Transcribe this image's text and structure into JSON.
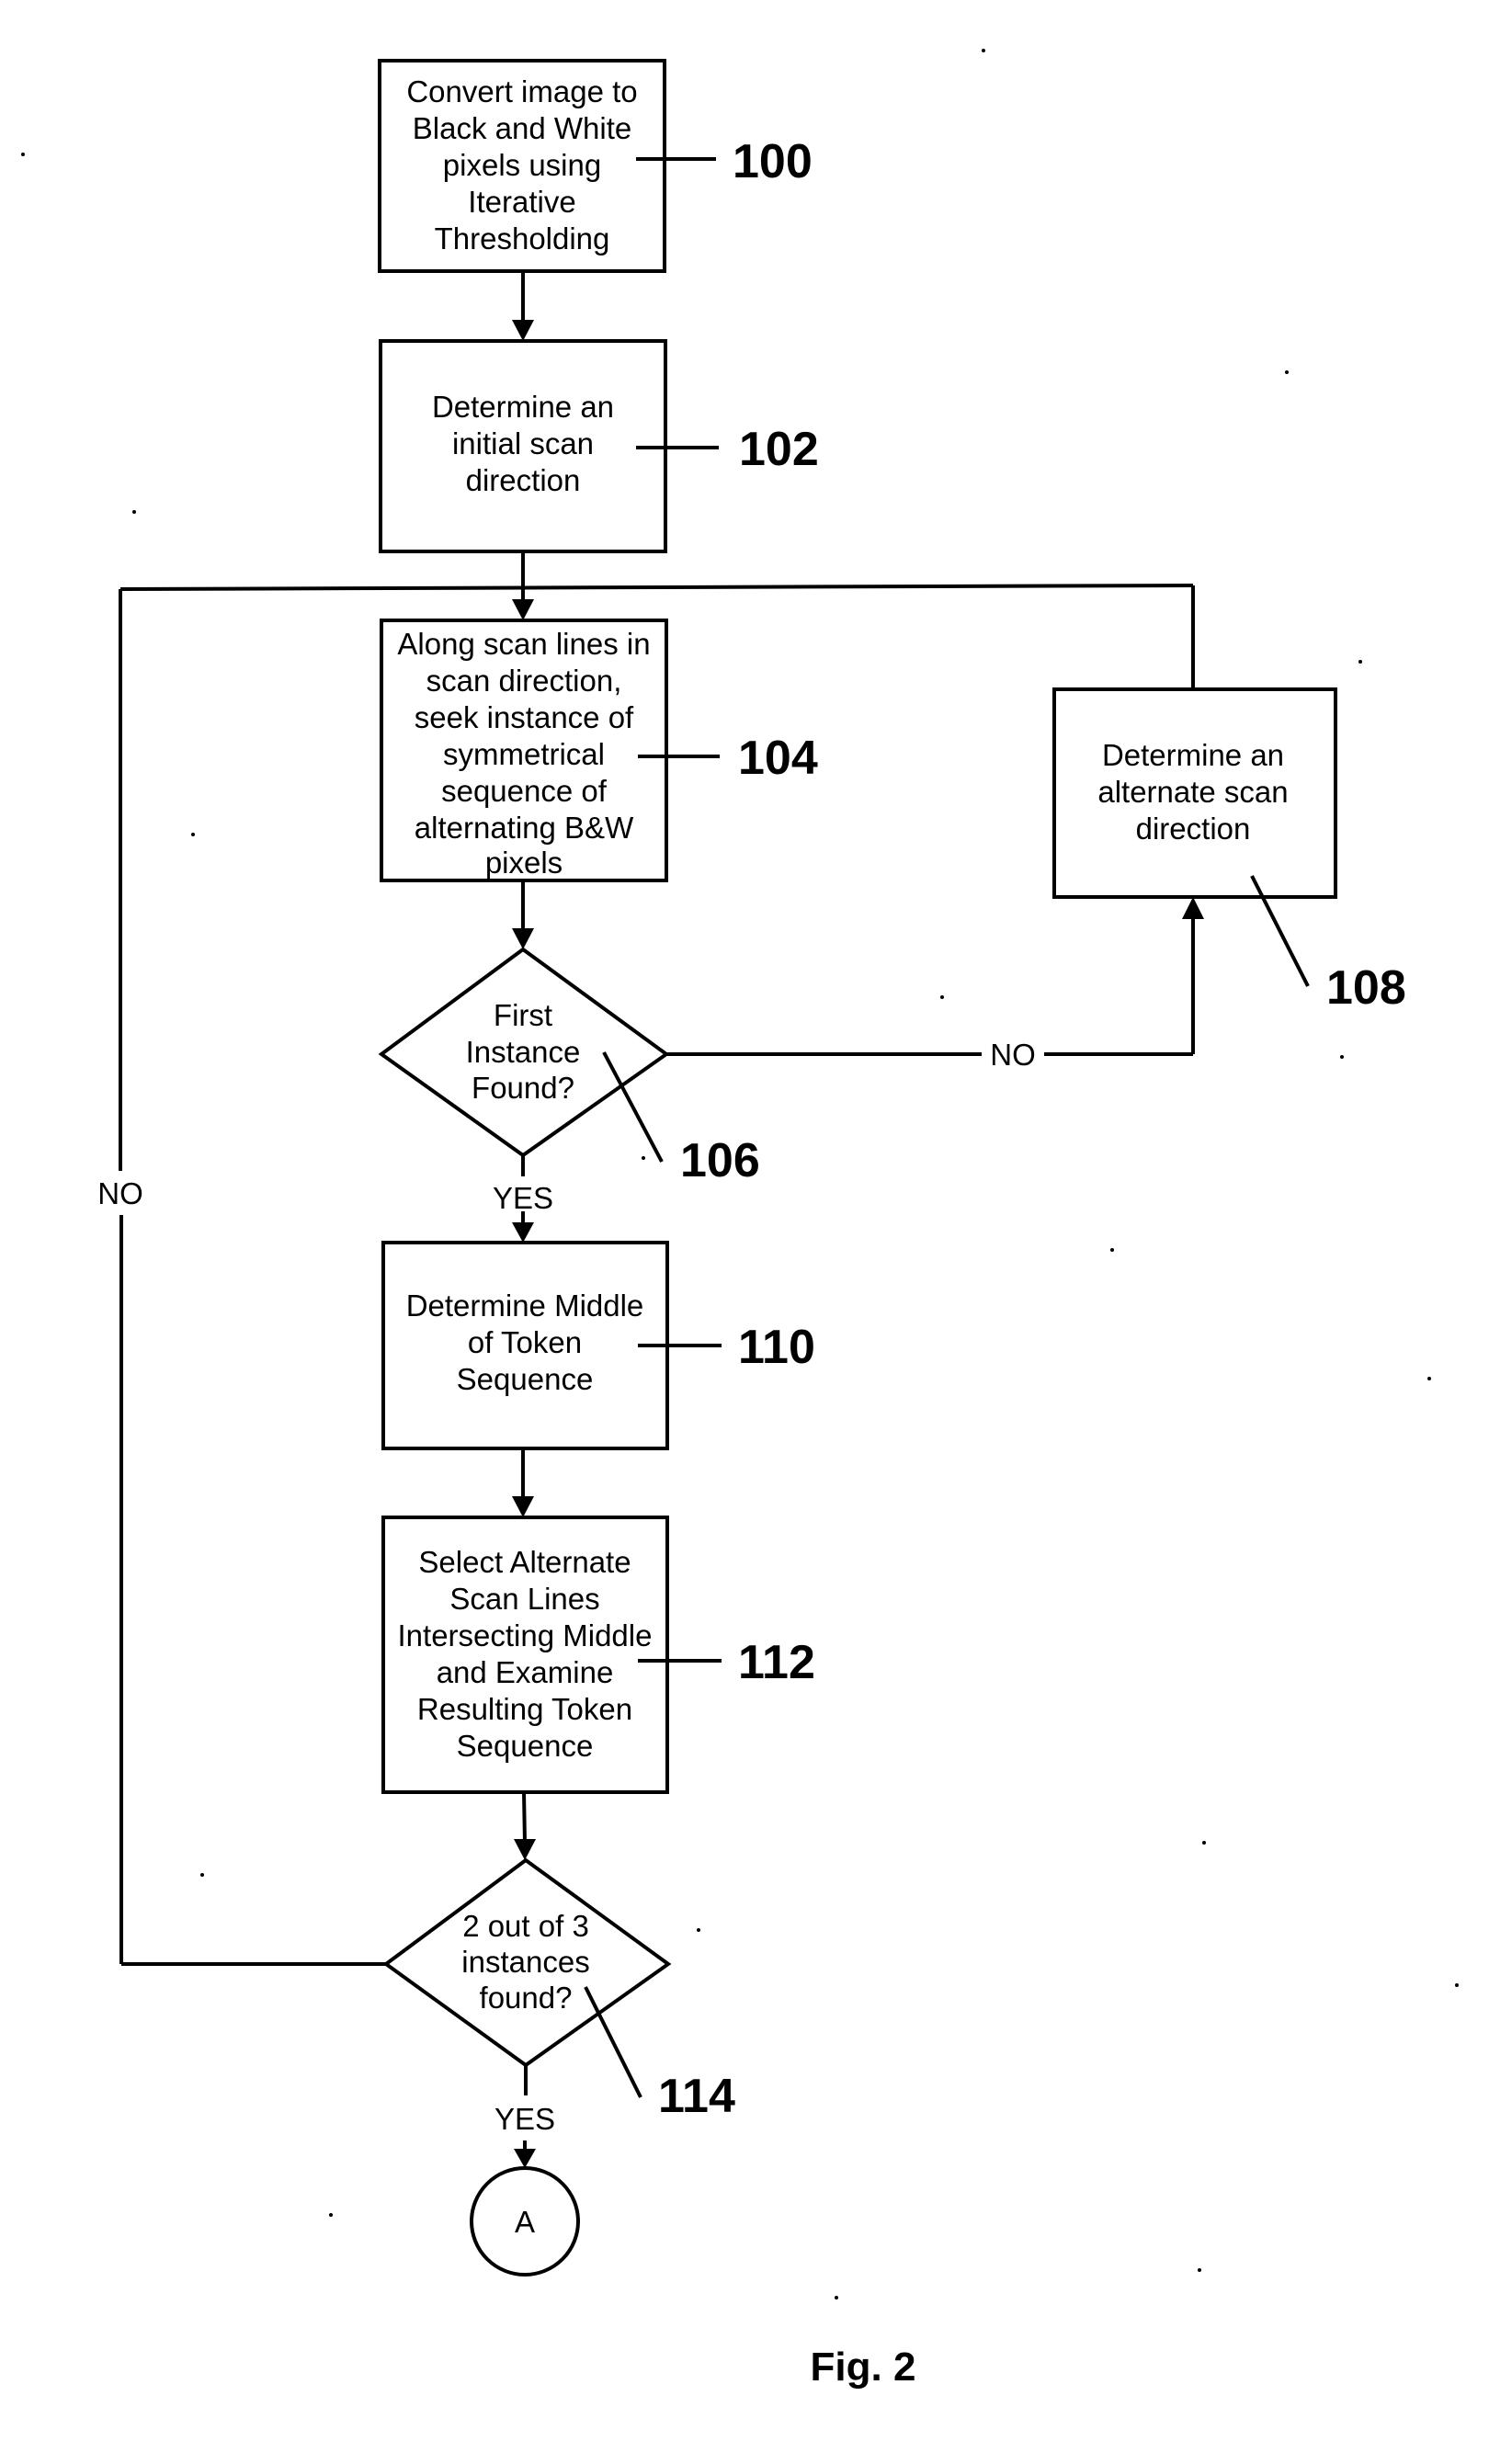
{
  "figure": {
    "caption": "Fig. 2",
    "colors": {
      "ink": "#000000",
      "paper": "#ffffff"
    }
  },
  "nodes": [
    {
      "id": "100",
      "type": "process",
      "ref": "100",
      "lines": [
        "Convert image to",
        "Black and White",
        "pixels using",
        "Iterative",
        "Thresholding"
      ]
    },
    {
      "id": "102",
      "type": "process",
      "ref": "102",
      "lines": [
        "Determine an",
        "initial scan",
        "direction"
      ]
    },
    {
      "id": "104",
      "type": "process",
      "ref": "104",
      "lines": [
        "Along scan lines in",
        "scan direction,",
        "seek instance of",
        "symmetrical",
        "sequence of",
        "alternating B&W",
        "pixels"
      ]
    },
    {
      "id": "106",
      "type": "decision",
      "ref": "106",
      "lines": [
        "First",
        "Instance",
        "Found?"
      ]
    },
    {
      "id": "108",
      "type": "process",
      "ref": "108",
      "lines": [
        "Determine an",
        "alternate scan",
        "direction"
      ]
    },
    {
      "id": "110",
      "type": "process",
      "ref": "110",
      "lines": [
        "Determine Middle",
        "of Token",
        "Sequence"
      ]
    },
    {
      "id": "112",
      "type": "process",
      "ref": "112",
      "lines": [
        "Select Alternate",
        "Scan Lines",
        "Intersecting Middle",
        "and Examine",
        "Resulting Token",
        "Sequence"
      ]
    },
    {
      "id": "114",
      "type": "decision",
      "ref": "114",
      "lines": [
        "2 out of 3",
        "instances",
        "found?"
      ]
    },
    {
      "id": "A",
      "type": "connector",
      "lines": [
        "A"
      ]
    }
  ],
  "edges": [
    {
      "from": "100",
      "to": "102",
      "label": ""
    },
    {
      "from": "102",
      "to": "104",
      "label": ""
    },
    {
      "from": "104",
      "to": "106",
      "label": ""
    },
    {
      "from": "106",
      "to": "110",
      "label": "YES"
    },
    {
      "from": "106",
      "to": "108",
      "label": "NO"
    },
    {
      "from": "108",
      "to": "104",
      "label": ""
    },
    {
      "from": "110",
      "to": "112",
      "label": ""
    },
    {
      "from": "112",
      "to": "114",
      "label": ""
    },
    {
      "from": "114",
      "to": "A",
      "label": "YES"
    },
    {
      "from": "114",
      "to": "104",
      "label": "NO"
    }
  ],
  "labels": {
    "yes_106": "YES",
    "no_106": "NO",
    "yes_114": "YES",
    "no_114": "NO"
  }
}
